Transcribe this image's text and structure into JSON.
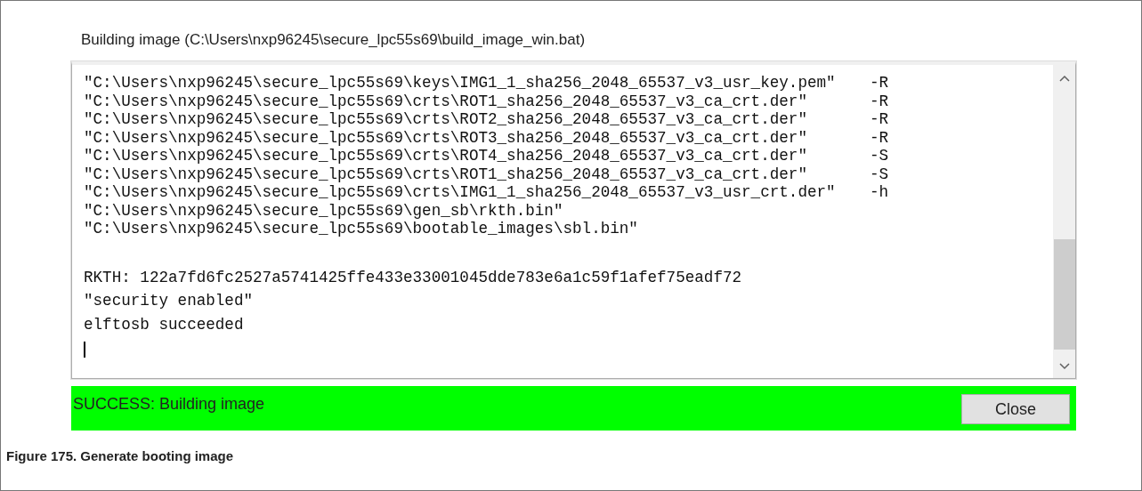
{
  "window": {
    "title": "Building image (C:\\Users\\nxp96245\\secure_lpc55s69\\build_image_win.bat)"
  },
  "console": {
    "paths": [
      {
        "text": "\"C:\\Users\\nxp96245\\secure_lpc55s69\\keys\\IMG1_1_sha256_2048_65537_v3_usr_key.pem\"",
        "flag": "-R"
      },
      {
        "text": "\"C:\\Users\\nxp96245\\secure_lpc55s69\\crts\\ROT1_sha256_2048_65537_v3_ca_crt.der\"",
        "flag": "-R"
      },
      {
        "text": "\"C:\\Users\\nxp96245\\secure_lpc55s69\\crts\\ROT2_sha256_2048_65537_v3_ca_crt.der\"",
        "flag": "-R"
      },
      {
        "text": "\"C:\\Users\\nxp96245\\secure_lpc55s69\\crts\\ROT3_sha256_2048_65537_v3_ca_crt.der\"",
        "flag": "-R"
      },
      {
        "text": "\"C:\\Users\\nxp96245\\secure_lpc55s69\\crts\\ROT4_sha256_2048_65537_v3_ca_crt.der\"",
        "flag": "-S"
      },
      {
        "text": "\"C:\\Users\\nxp96245\\secure_lpc55s69\\crts\\ROT1_sha256_2048_65537_v3_ca_crt.der\"",
        "flag": "-S"
      },
      {
        "text": "\"C:\\Users\\nxp96245\\secure_lpc55s69\\crts\\IMG1_1_sha256_2048_65537_v3_usr_crt.der\"",
        "flag": "-h"
      },
      {
        "text": "\"C:\\Users\\nxp96245\\secure_lpc55s69\\gen_sb\\rkth.bin\""
      },
      {
        "text": "\"C:\\Users\\nxp96245\\secure_lpc55s69\\bootable_images\\sbl.bin\""
      }
    ],
    "messages": [
      "RKTH: 122a7fd6fc2527a5741425ffe433e33001045dde783e6a1c59f1afef75eadf72",
      "\"security enabled\"",
      "elftosb succeeded"
    ]
  },
  "status_bar": {
    "kind": "success",
    "text": "SUCCESS: Building image",
    "button": "Close"
  },
  "caption": "Figure 175.  Generate booting image"
}
